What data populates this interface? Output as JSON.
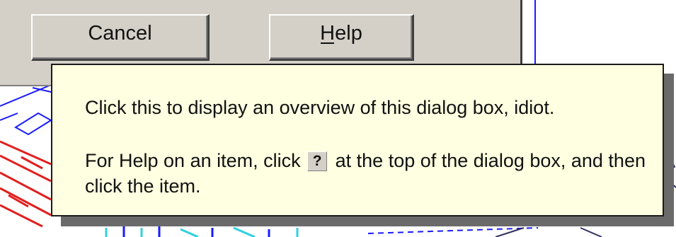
{
  "dialog": {
    "cancel_label": "Cancel",
    "help_label_mnemonic": "H",
    "help_label_rest": "elp"
  },
  "tooltip": {
    "line1": "Click this to display an overview of this dialog box, idiot.",
    "para2_before": "For Help on an item, click",
    "question_glyph": "?",
    "para2_after": "at the top of the dialog box, and then click the item."
  },
  "colors": {
    "dialog_face": "#d4d0c8",
    "tooltip_bg": "#ffffe1",
    "cad_red": "#e02020",
    "cad_blue": "#1a1aff",
    "cad_cyan": "#30d0e0"
  }
}
